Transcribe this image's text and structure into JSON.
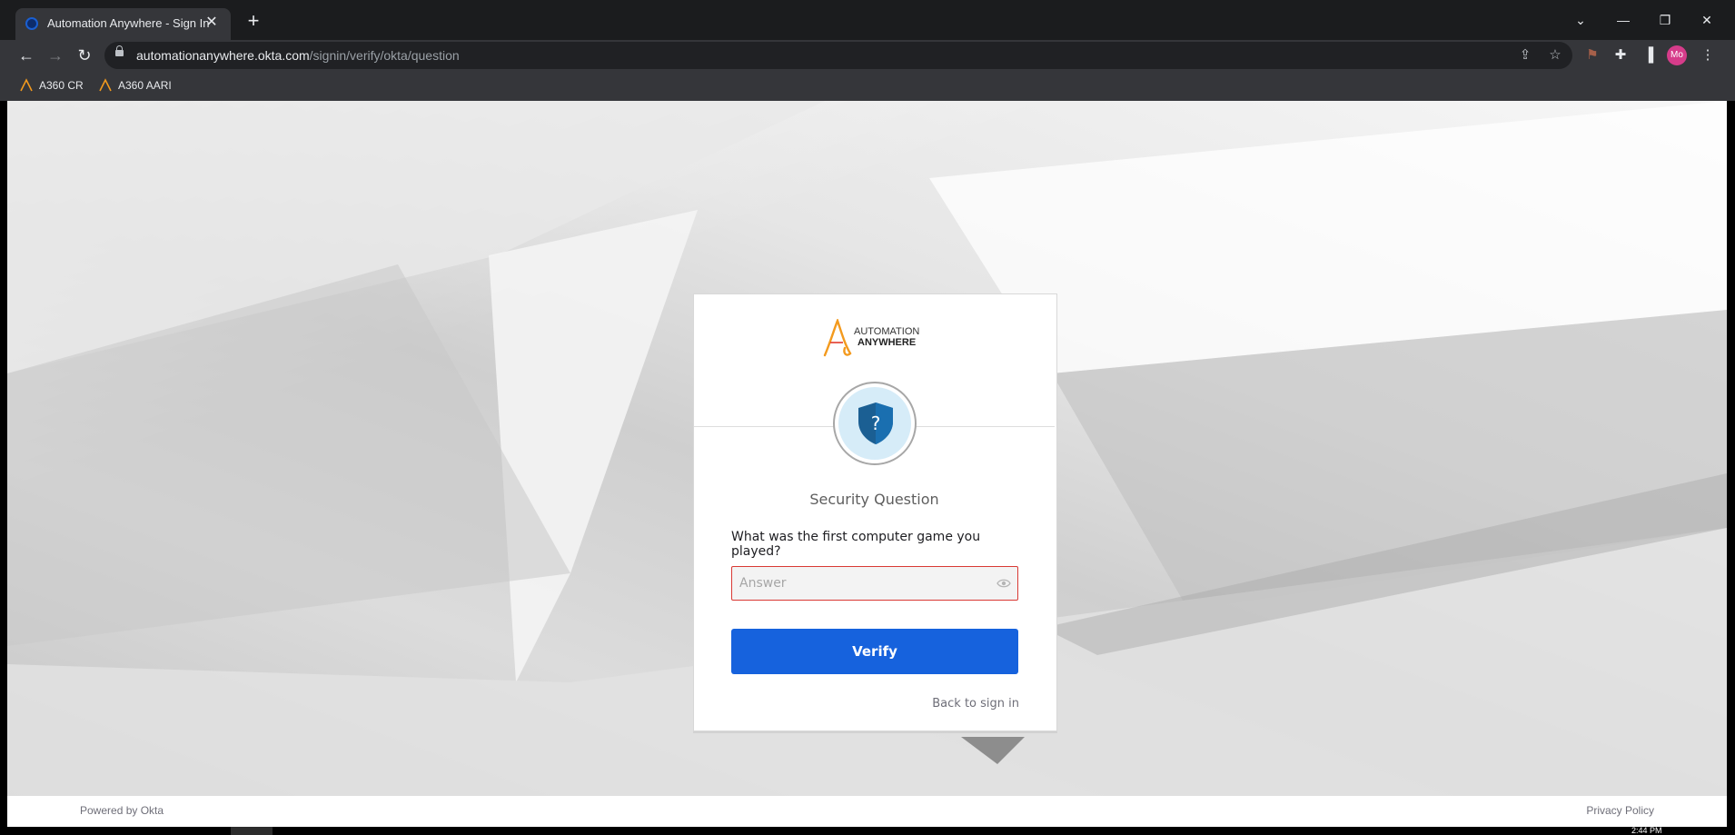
{
  "browser": {
    "tab_title": "Automation Anywhere - Sign In",
    "url_host": "automationanywhere.okta.com",
    "url_path": "/signin/verify/okta/question",
    "profile_initials": "Mo",
    "bookmarks": [
      {
        "label": "A360 CR",
        "icon": "automation-anywhere-logo-icon"
      },
      {
        "label": "A360 AARI",
        "icon": "automation-anywhere-logo-icon"
      }
    ]
  },
  "card": {
    "logo_line1": "AUTOMATION",
    "logo_line2": "ANYWHERE",
    "factor_icon": "shield-question-icon",
    "title": "Security Question",
    "question": "What was the first computer game you played?",
    "answer_placeholder": "Answer",
    "answer_value": "",
    "verify_label": "Verify",
    "back_link": "Back to sign in"
  },
  "footer": {
    "powered_by": "Powered by Okta",
    "privacy": "Privacy Policy"
  },
  "taskbar": {
    "time": "2:44 PM"
  },
  "colors": {
    "primary_button": "#1662dd",
    "error_border": "#d93934",
    "brand_orange": "#f39a1e"
  }
}
